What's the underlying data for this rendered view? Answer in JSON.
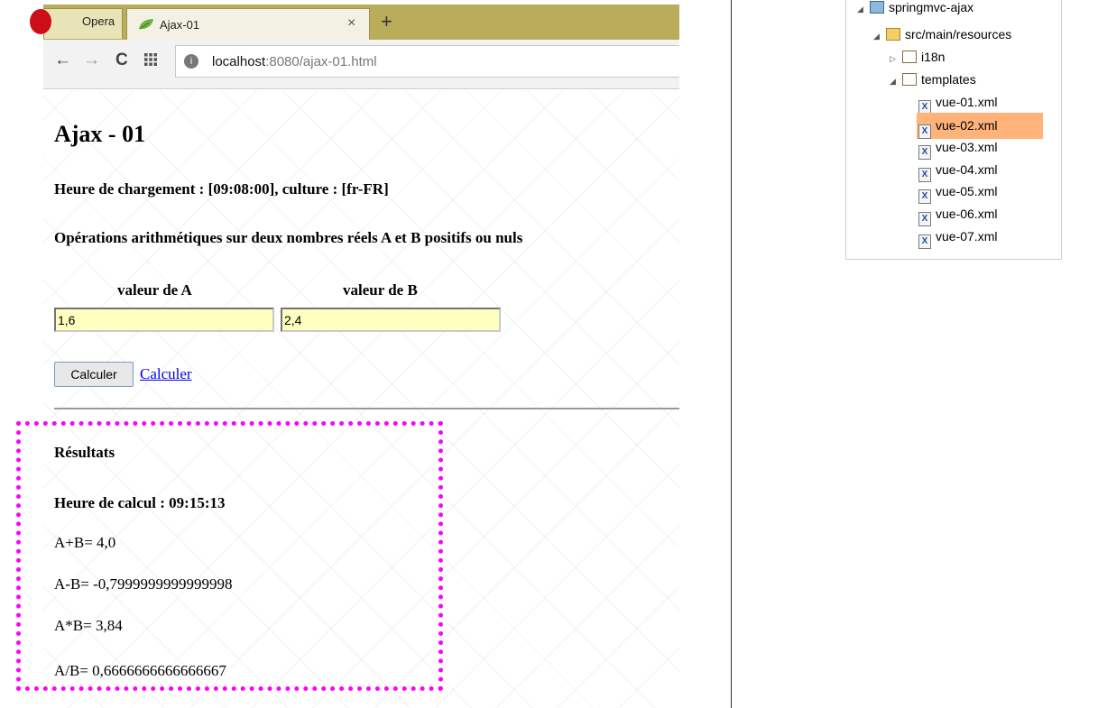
{
  "browser": {
    "opera_label": "Opera",
    "tab_title": "Ajax-01",
    "tab_close": "×",
    "new_tab": "+",
    "url_host": "localhost",
    "url_rest": ":8080/ajax-01.html"
  },
  "page": {
    "title": "Ajax - 01",
    "load_info": "Heure de chargement : [09:08:00], culture : [fr-FR]",
    "ops_title": "Opérations arithmétiques sur deux nombres réels A et B positifs ou nuls",
    "label_a": "valeur de A",
    "label_b": "valeur de B",
    "value_a": "1,6",
    "value_b": "2,4",
    "calc_button": "Calculer",
    "calc_link": "Calculer"
  },
  "results": {
    "title": "Résultats",
    "calc_time": "Heure de calcul : 09:15:13",
    "sum": "A+B= 4,0",
    "diff": "A-B= -0,7999999999999998",
    "prod": "A*B= 3,84",
    "div": "A/B= 0,6666666666666667"
  },
  "tree": {
    "project": "springmvc-ajax",
    "src": "src/main/resources",
    "i18n": "i18n",
    "templates": "templates",
    "files": [
      "vue-01.xml",
      "vue-02.xml",
      "vue-03.xml",
      "vue-04.xml",
      "vue-05.xml",
      "vue-06.xml",
      "vue-07.xml"
    ],
    "selected_file": "vue-02.xml",
    "xml_icon_letter": "X"
  },
  "colors": {
    "highlight_border": "#ff00ff",
    "selection": "#ffb27a",
    "tab_bar": "#b9ad5c",
    "input_background": "#ffffc0"
  }
}
